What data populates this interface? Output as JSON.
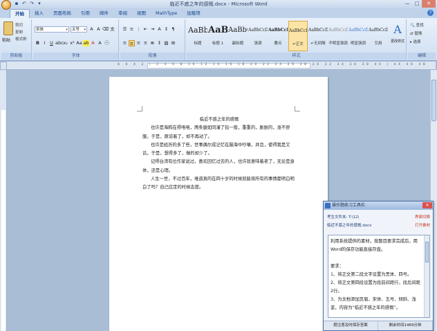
{
  "window": {
    "title": "临近不惑之年的感慨.docx - Microsoft Word",
    "qat_icons": [
      "save-icon",
      "undo-icon",
      "redo-icon",
      "customize-icon"
    ],
    "minimize": "—",
    "maximize": "□",
    "close": "✕"
  },
  "tabs": [
    "开始",
    "插入",
    "页面布局",
    "引用",
    "邮件",
    "审阅",
    "视图",
    "MathType",
    "加载项"
  ],
  "active_tab": "开始",
  "ribbon": {
    "clipboard": {
      "paste": "粘贴",
      "cut": "剪切",
      "copy": "复制",
      "format_painter": "格式刷",
      "label": "剪贴板"
    },
    "font": {
      "name": "宋体",
      "size": "五号",
      "label": "字体"
    },
    "paragraph": {
      "label": "段落"
    },
    "styles": {
      "label": "样式",
      "items": [
        {
          "sample": "AaBbC",
          "name": "标题"
        },
        {
          "sample": "AaBb",
          "name": "标题 1"
        },
        {
          "sample": "AaBbC",
          "name": "副标题"
        },
        {
          "sample": "AaBbCcD",
          "name": "强调"
        },
        {
          "sample": "AaBbCcD",
          "name": "要点"
        },
        {
          "sample": "AaBbCcD",
          "name": "↵正文"
        },
        {
          "sample": "AaBbCcD",
          "name": "↵无间隔"
        },
        {
          "sample": "AaBbCcD",
          "name": "不明显强调"
        },
        {
          "sample": "AaBbCcD",
          "name": "明显强调"
        },
        {
          "sample": "AaBbCcD",
          "name": "引用"
        }
      ],
      "change_styles": "更改样式"
    },
    "editing": {
      "find": "查找",
      "replace": "替换",
      "select": "选择",
      "label": "编辑"
    }
  },
  "ruler": {
    "ticks": "8 6 4 2 | 2 4 6 8 10 12 14 16 18 20 22 24 26 28 30 32 34 36 38 40 | 44 46 48"
  },
  "document": {
    "title": "临近不惑之年的感慨",
    "paragraphs": [
      "也许是海鸥在得咯咯，两条腿如同灌了铅一般，重重的，胀胀的，涨不舒服，于是，原谅着了，却不再动了。",
      "也许是经历的多了些，世事偶尔成记忆在脑海中吵嚷，并且，使得我是又讥，于是，想得多了，做的却少了。",
      "记得台湾有位作家说过，喜欢回忆过去的人，也许就意味着老了，无论是身体，还是心理。",
      "人生一世，不过百年，难道真的在四十岁的时候就能将所有的事情都明白明白了吗？自己应定的时候态度。"
    ]
  },
  "task_tool": {
    "title": "操作题练习工具栏",
    "file_label": "考生文件夹: T:\\12\\",
    "file_name": "临近不惑之年的感慨.docx",
    "switch_link": "界面切换",
    "open_material": "打开素材",
    "task_text": "利用系统提供的素材，按题目要求完成后，用Word的保存功能直接存盘。\n\n要求：\n1、将正文第二段文字设置为黑体、四号。\n2、将正文第四段设置为段前间距行，段后间距2行。\n3、为文档添加页眉，宋体、五号、倾斜、浅蓝，内容为“临近不惑之年的感慨”。",
    "btn_left": "题注意及时保存答案",
    "btn_right": "剩余时间1469分钟"
  }
}
